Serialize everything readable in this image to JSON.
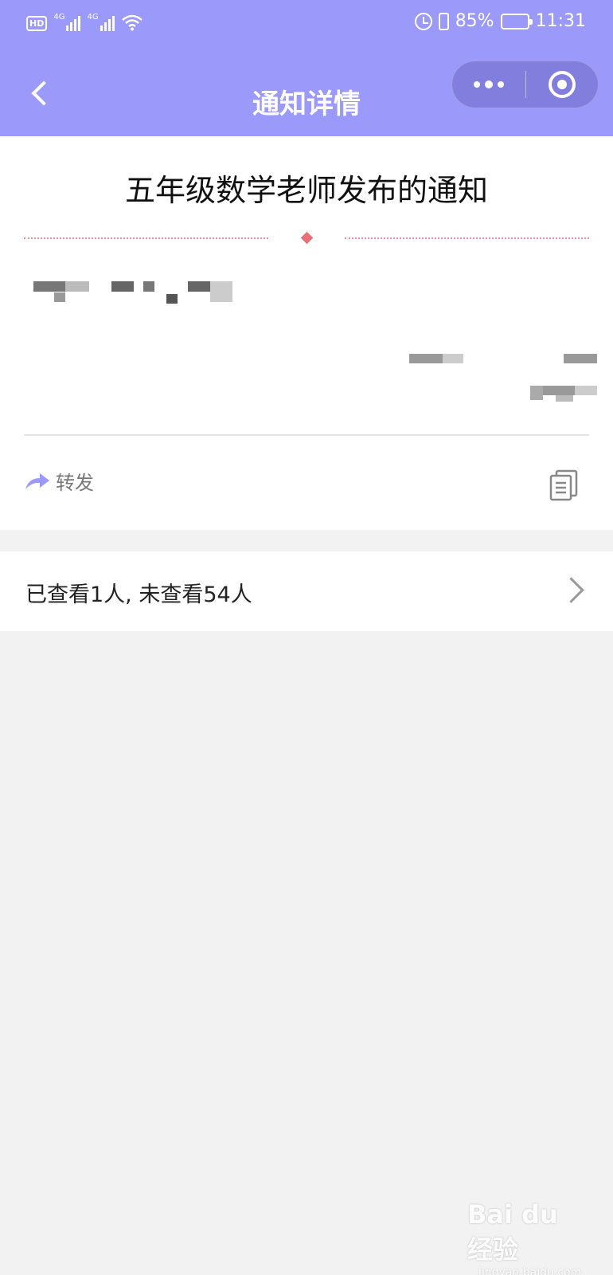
{
  "status_bar": {
    "network_left": "HD",
    "signal1": "4G",
    "signal2": "4G",
    "battery_percent": "85%",
    "battery_level": 0.85,
    "time": "11:31"
  },
  "nav": {
    "title": "通知详情",
    "back_icon": "chevron-left-icon",
    "more_icon": "more-dots-icon",
    "close_icon": "target-circle-icon"
  },
  "notice": {
    "title": "五年级数学老师发布的通知",
    "forward_label": "转发",
    "forward_icon": "share-arrow-icon",
    "copy_icon": "copy-document-icon"
  },
  "viewed": {
    "text": "已查看1人, 未查看54人"
  },
  "watermark": {
    "main": "Bai du 经验",
    "sub": "jingyan.baidu.com"
  },
  "colors": {
    "header": "#9b99f9",
    "divider": "#e58f95",
    "diamond": "#e66f78",
    "background": "#f2f2f2"
  }
}
